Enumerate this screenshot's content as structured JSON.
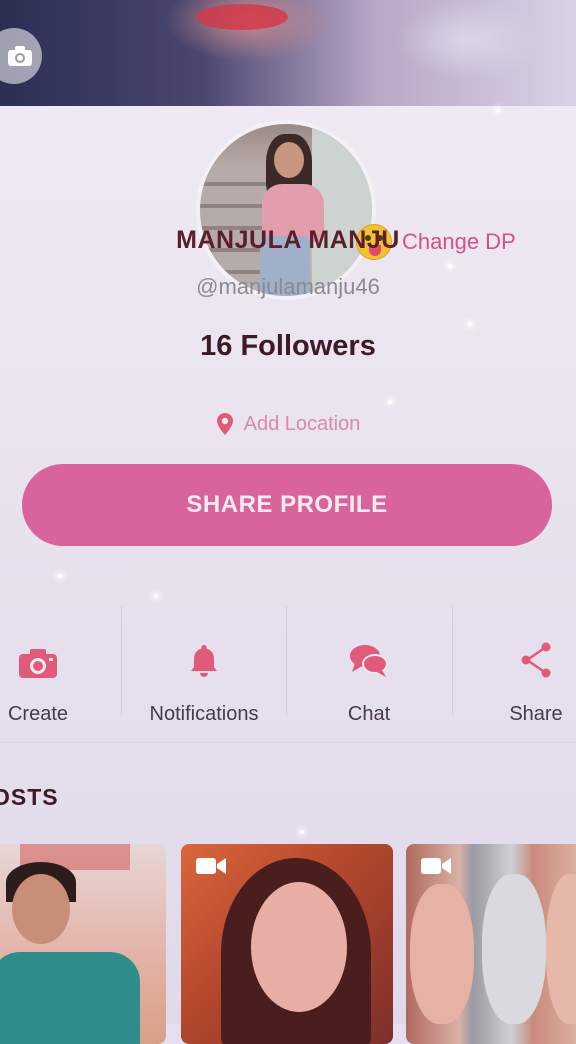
{
  "profile": {
    "name": "MANJULA MANJU",
    "handle": "@manjulamanju46",
    "followers": "16 Followers",
    "change_dp_label": "Change DP",
    "add_location_label": "Add Location",
    "share_profile_label": "SHARE PROFILE"
  },
  "actions": [
    {
      "label": "Create",
      "icon": "camera-icon"
    },
    {
      "label": "Notifications",
      "icon": "bell-icon"
    },
    {
      "label": "Chat",
      "icon": "chat-bubbles-icon"
    },
    {
      "label": "Share",
      "icon": "share-icon"
    }
  ],
  "posts": {
    "title": "OSTS",
    "items": [
      {
        "type": "image"
      },
      {
        "type": "video",
        "icon": "video-camera-icon"
      },
      {
        "type": "video",
        "icon": "video-camera-icon"
      }
    ]
  },
  "colors": {
    "accent": "#d9649b",
    "name_text": "#5b1e2c",
    "icon_pink": "#e05a7a"
  }
}
